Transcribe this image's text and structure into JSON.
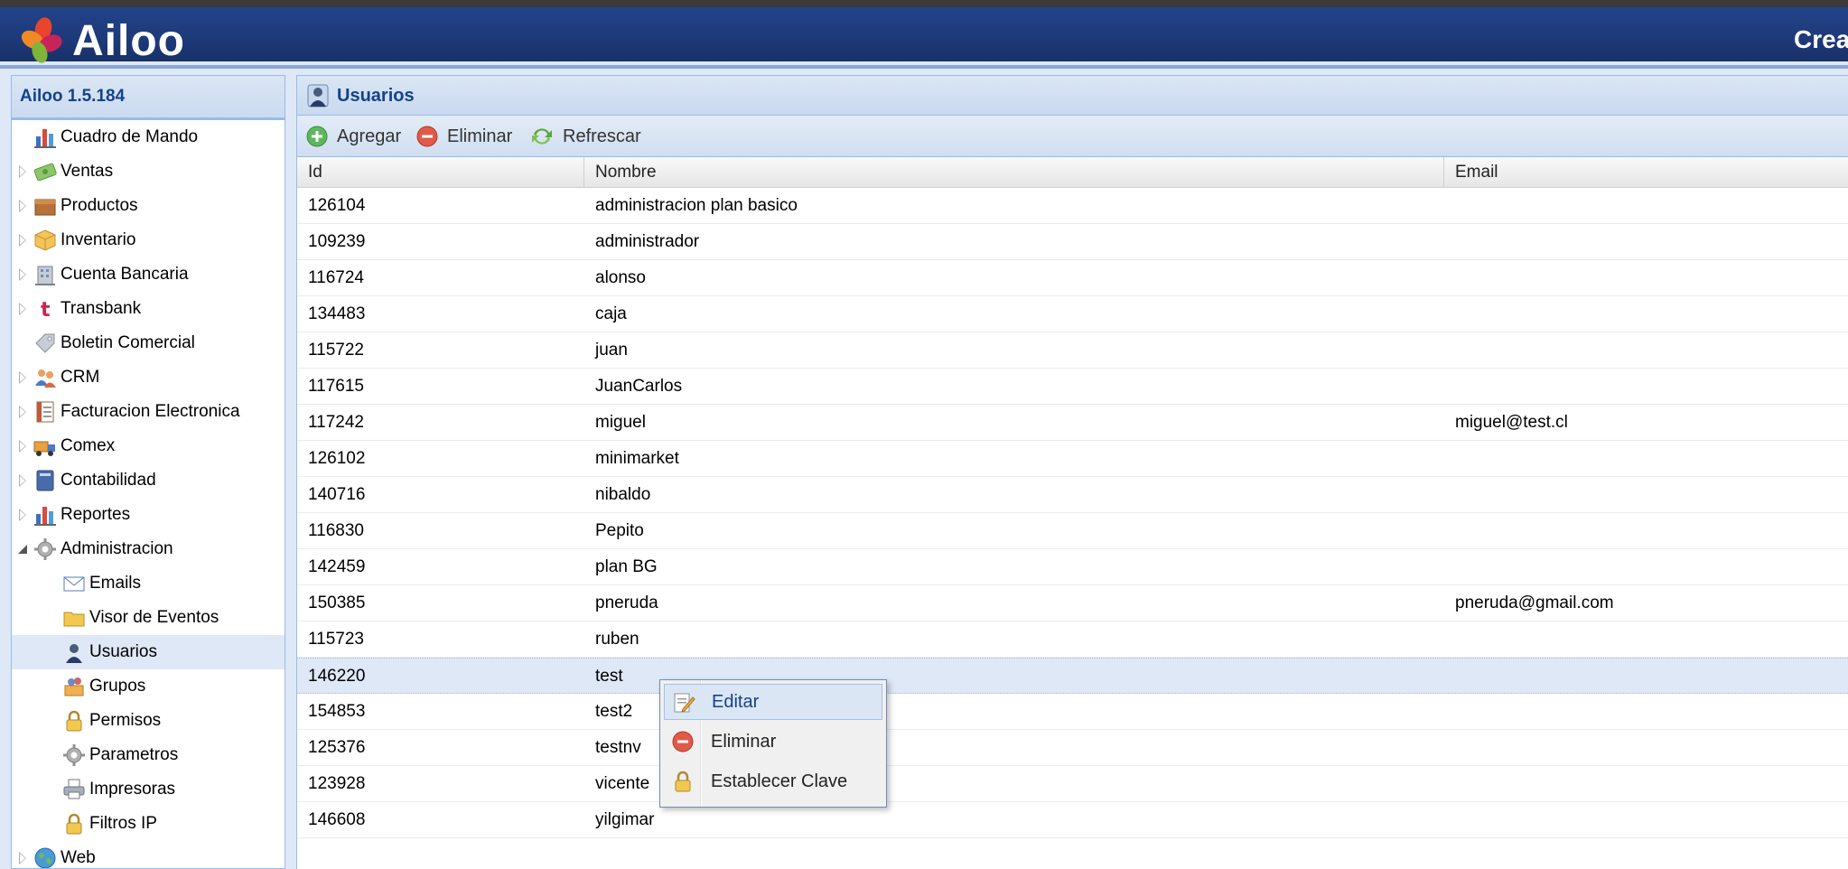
{
  "header": {
    "brand": "Ailoo",
    "right_text": "Crea"
  },
  "sidebar": {
    "title": "Ailoo 1.5.184",
    "items": [
      {
        "label": "Cuadro de Mando",
        "icon": "chart-bars-icon",
        "expander": "none"
      },
      {
        "label": "Ventas",
        "icon": "money-icon",
        "expander": "collapsed"
      },
      {
        "label": "Productos",
        "icon": "box-icon",
        "expander": "collapsed"
      },
      {
        "label": "Inventario",
        "icon": "package-icon",
        "expander": "collapsed"
      },
      {
        "label": "Cuenta Bancaria",
        "icon": "bank-building-icon",
        "expander": "collapsed"
      },
      {
        "label": "Transbank",
        "icon": "transbank-icon",
        "expander": "collapsed"
      },
      {
        "label": "Boletin Comercial",
        "icon": "tag-icon",
        "expander": "none"
      },
      {
        "label": "CRM",
        "icon": "people-icon",
        "expander": "collapsed"
      },
      {
        "label": "Facturacion Electronica",
        "icon": "invoice-icon",
        "expander": "collapsed"
      },
      {
        "label": "Comex",
        "icon": "truck-icon",
        "expander": "collapsed"
      },
      {
        "label": "Contabilidad",
        "icon": "ledger-book-icon",
        "expander": "collapsed"
      },
      {
        "label": "Reportes",
        "icon": "chart-bars-icon",
        "expander": "collapsed"
      },
      {
        "label": "Administracion",
        "icon": "gear-icon",
        "expander": "expanded"
      },
      {
        "label": "Emails",
        "icon": "envelope-icon",
        "expander": "child"
      },
      {
        "label": "Visor de Eventos",
        "icon": "folder-icon",
        "expander": "child"
      },
      {
        "label": "Usuarios",
        "icon": "user-icon",
        "expander": "child",
        "selected": true
      },
      {
        "label": "Grupos",
        "icon": "group-icon",
        "expander": "child"
      },
      {
        "label": "Permisos",
        "icon": "lock-icon",
        "expander": "child"
      },
      {
        "label": "Parametros",
        "icon": "gear-icon",
        "expander": "child"
      },
      {
        "label": "Impresoras",
        "icon": "printer-icon",
        "expander": "child"
      },
      {
        "label": "Filtros IP",
        "icon": "lock-icon",
        "expander": "child"
      },
      {
        "label": "Web",
        "icon": "globe-icon",
        "expander": "collapsed"
      }
    ]
  },
  "panel": {
    "title": "Usuarios",
    "toolbar": {
      "add_label": "Agregar",
      "delete_label": "Eliminar",
      "refresh_label": "Refrescar"
    },
    "columns": [
      "Id",
      "Nombre",
      "Email"
    ],
    "rows": [
      {
        "id": "126104",
        "nombre": "administracion plan basico",
        "email": ""
      },
      {
        "id": "109239",
        "nombre": "administrador",
        "email": ""
      },
      {
        "id": "116724",
        "nombre": "alonso",
        "email": ""
      },
      {
        "id": "134483",
        "nombre": "caja",
        "email": ""
      },
      {
        "id": "115722",
        "nombre": "juan",
        "email": ""
      },
      {
        "id": "117615",
        "nombre": "JuanCarlos",
        "email": ""
      },
      {
        "id": "117242",
        "nombre": "miguel",
        "email": "miguel@test.cl"
      },
      {
        "id": "126102",
        "nombre": "minimarket",
        "email": ""
      },
      {
        "id": "140716",
        "nombre": "nibaldo",
        "email": ""
      },
      {
        "id": "116830",
        "nombre": "Pepito",
        "email": ""
      },
      {
        "id": "142459",
        "nombre": "plan BG",
        "email": ""
      },
      {
        "id": "150385",
        "nombre": "pneruda",
        "email": "pneruda@gmail.com"
      },
      {
        "id": "115723",
        "nombre": "ruben",
        "email": ""
      },
      {
        "id": "146220",
        "nombre": "test",
        "email": "",
        "selected": true
      },
      {
        "id": "154853",
        "nombre": "test2",
        "email": ""
      },
      {
        "id": "125376",
        "nombre": "testnv",
        "email": ""
      },
      {
        "id": "123928",
        "nombre": "vicente",
        "email": ""
      },
      {
        "id": "146608",
        "nombre": "yilgimar",
        "email": ""
      }
    ]
  },
  "context_menu": {
    "items": [
      {
        "label": "Editar",
        "icon": "edit-icon",
        "active": true
      },
      {
        "label": "Eliminar",
        "icon": "delete-icon"
      },
      {
        "label": "Establecer Clave",
        "icon": "lock-icon"
      }
    ]
  },
  "colors": {
    "header_bg": "#1d3a7a",
    "panel_title": "#15428b",
    "selection": "#dfe8f6"
  }
}
